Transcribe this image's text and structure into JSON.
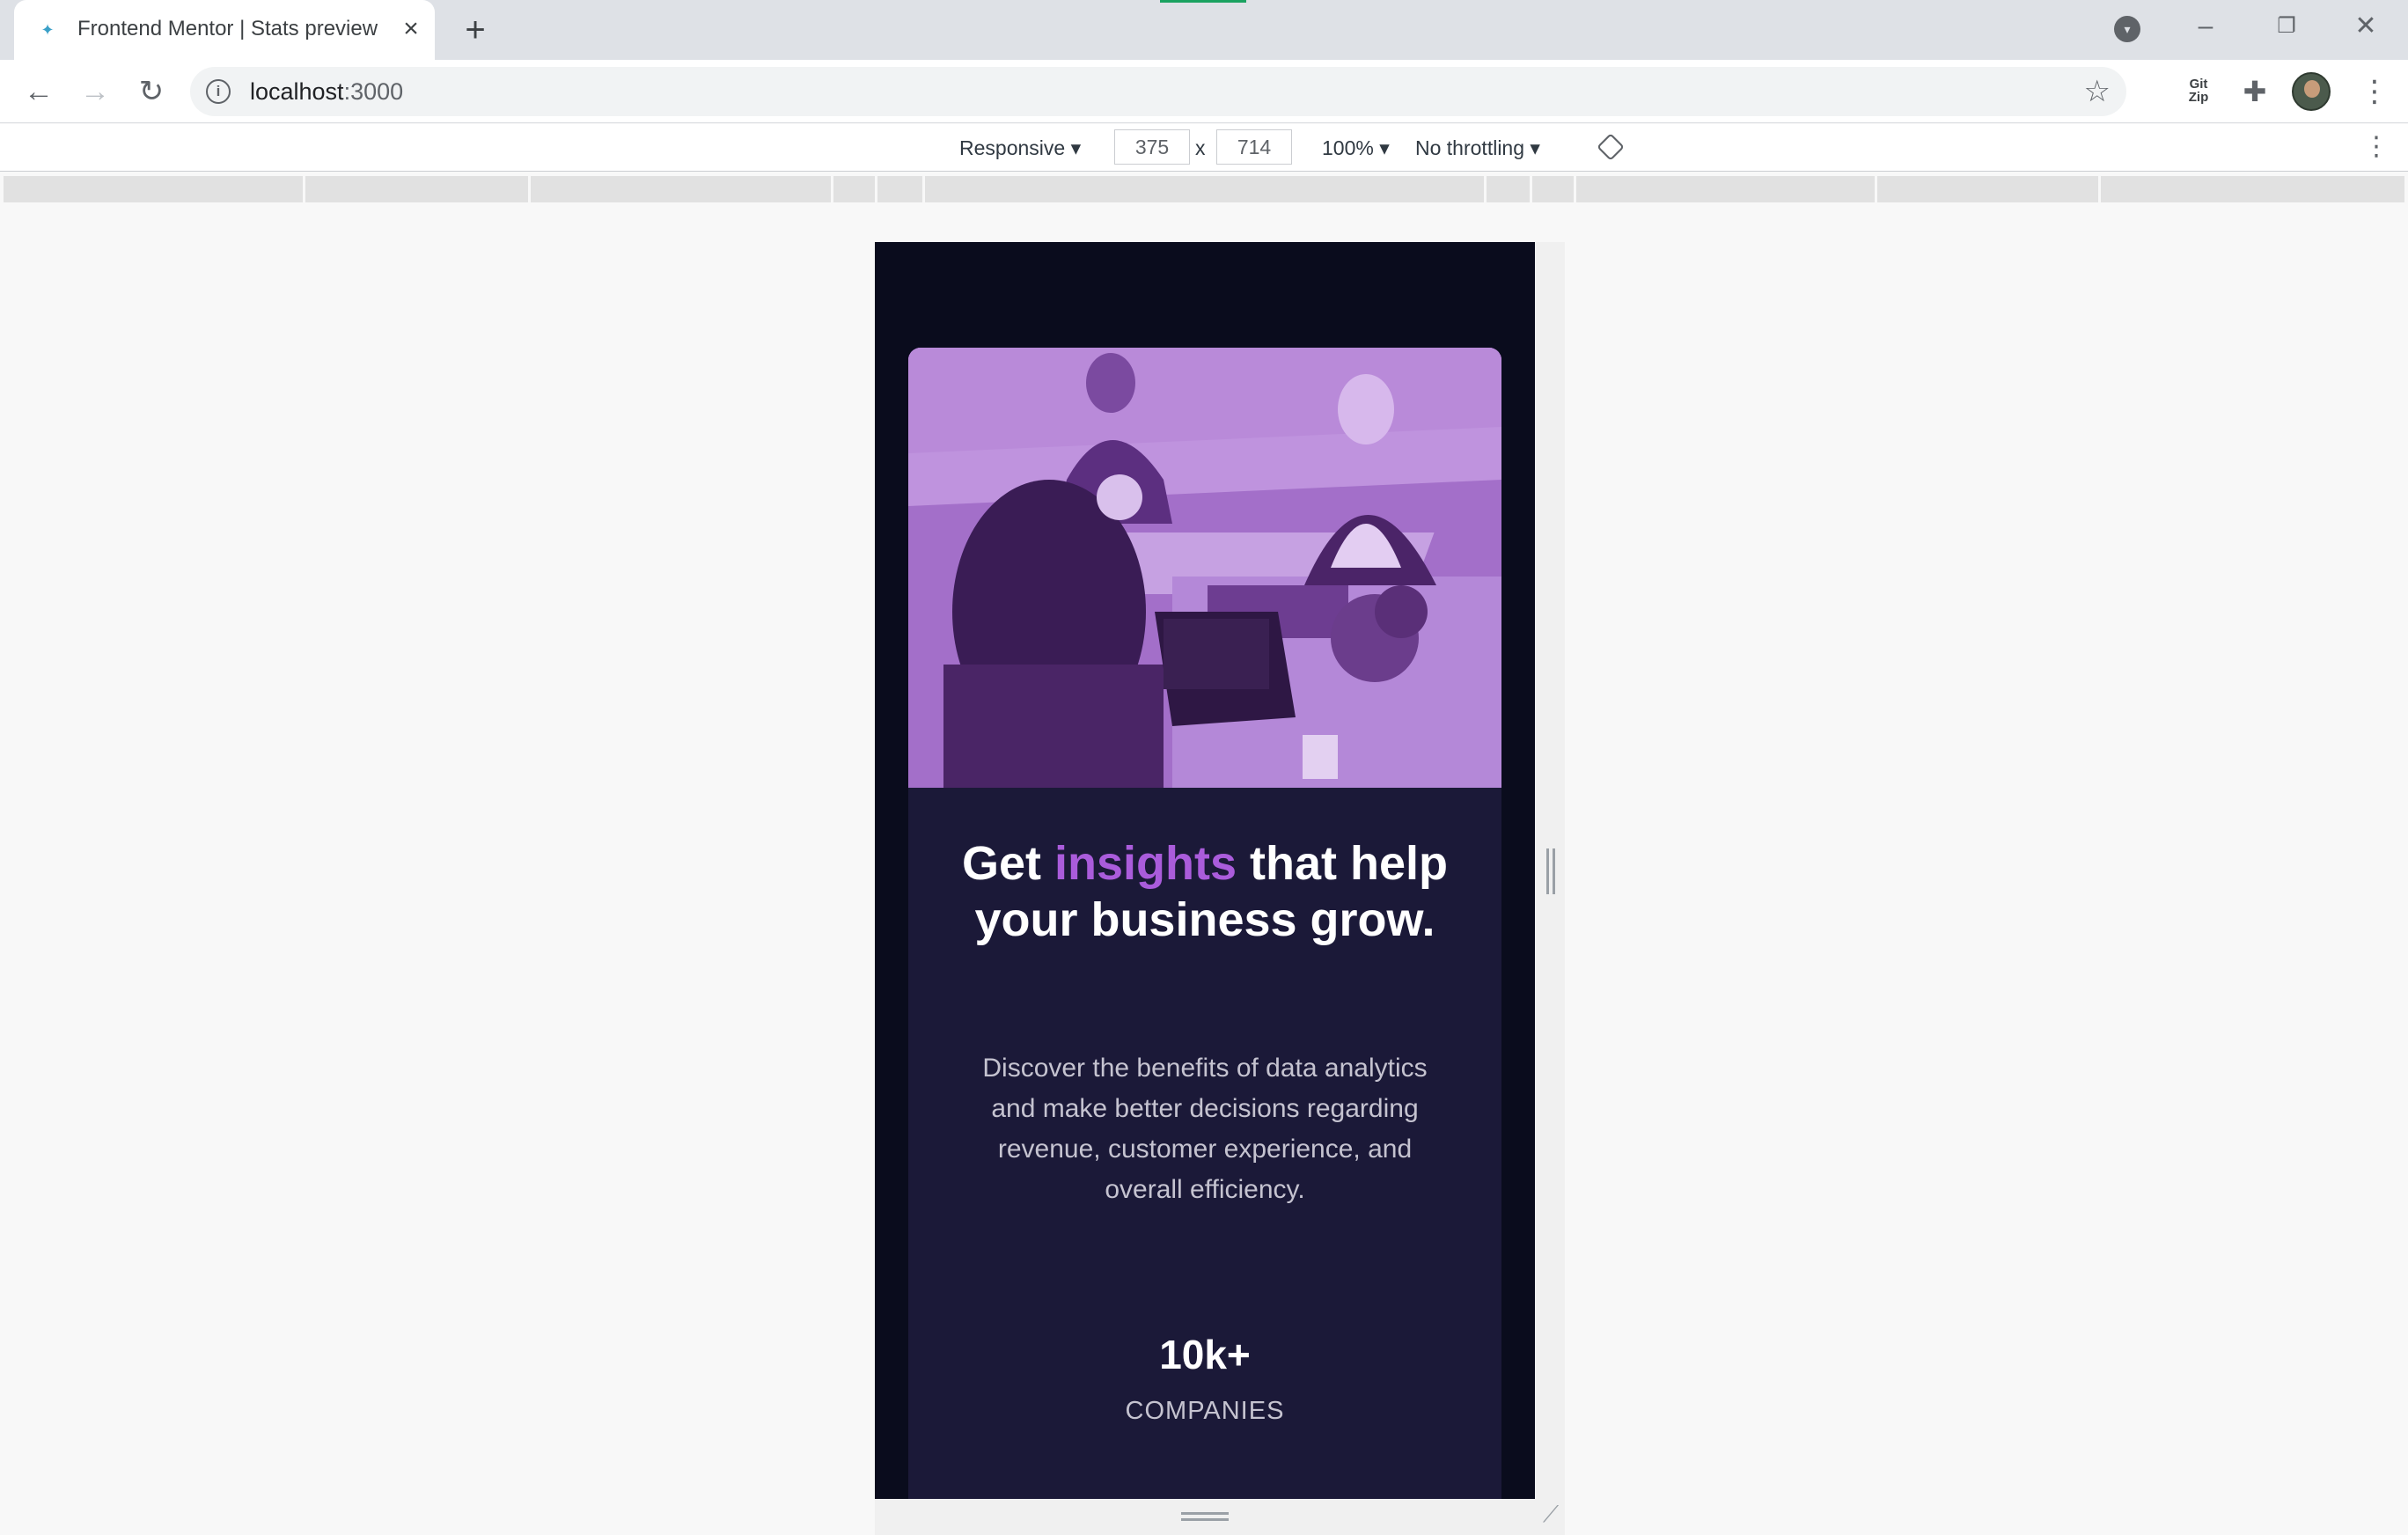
{
  "browser": {
    "tab": {
      "title": "Frontend Mentor | Stats preview",
      "favicon": "fm-favicon",
      "close_icon": "close-icon"
    },
    "new_tab_icon": "plus-icon",
    "address": {
      "host": "localhost",
      "port": ":3000"
    },
    "extensions": {
      "gitzip_line1": "Git",
      "gitzip_line2": "Zip"
    }
  },
  "devtools": {
    "device": "Responsive",
    "width": "375",
    "separator": "x",
    "height": "714",
    "zoom": "100%",
    "throttling": "No throttling"
  },
  "page": {
    "title_pre": "Get ",
    "title_accent": "insights",
    "title_post": " that help your business grow.",
    "description": "Discover the benefits of data analytics and make better decisions regarding revenue, customer experience, and overall efficiency.",
    "stat": {
      "value": "10k+",
      "label": "COMPANIES"
    },
    "colors": {
      "background": "#0a0c1d",
      "card": "#1b1938",
      "accent": "#aa5cdb",
      "image_tint": "#a96fd3"
    }
  }
}
